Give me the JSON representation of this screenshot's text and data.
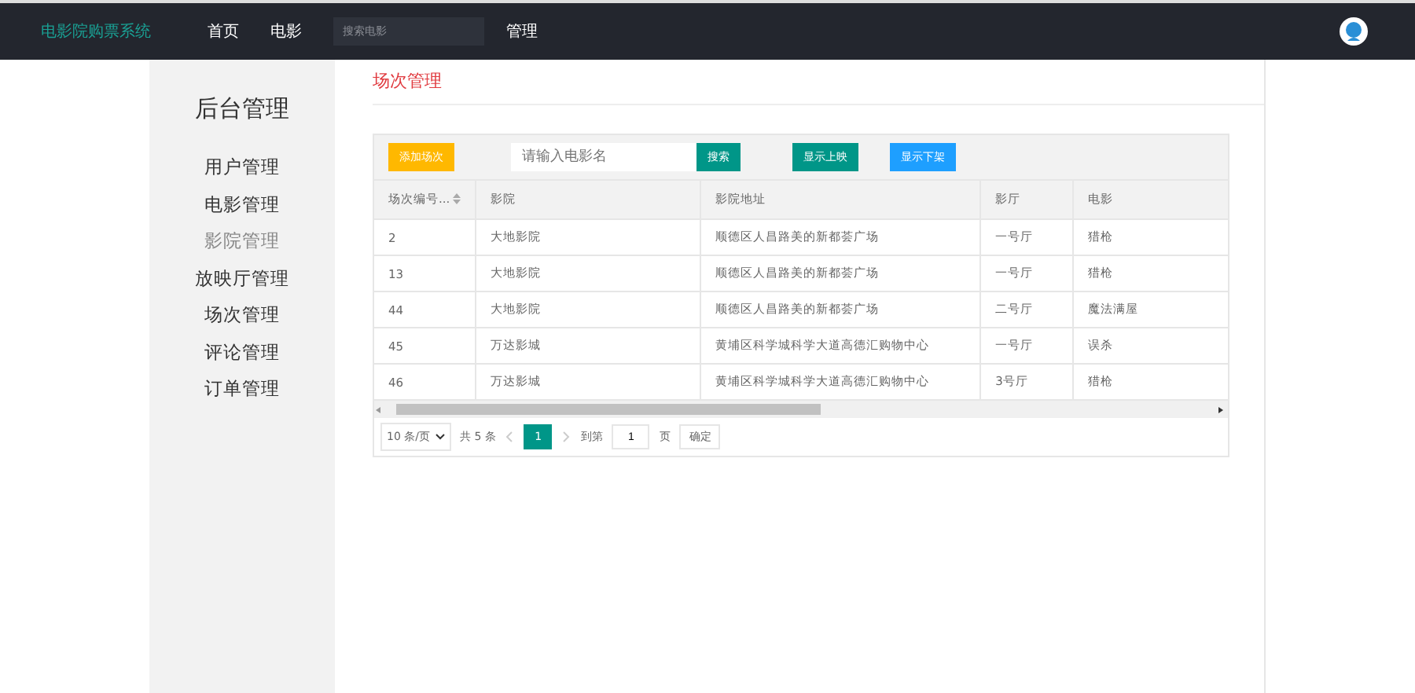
{
  "navbar": {
    "brand": "电影院购票系统",
    "links": [
      {
        "label": "首页"
      },
      {
        "label": "电影"
      }
    ],
    "search": {
      "placeholder": "搜索电影"
    },
    "admin_link": "管理"
  },
  "sidebar": {
    "title": "后台管理",
    "items": [
      {
        "label": "用户管理",
        "selected": false
      },
      {
        "label": "电影管理",
        "selected": false
      },
      {
        "label": "影院管理",
        "selected": true
      },
      {
        "label": "放映厅管理",
        "selected": false
      },
      {
        "label": "场次管理",
        "selected": false
      },
      {
        "label": "评论管理",
        "selected": false
      },
      {
        "label": "订单管理",
        "selected": false
      }
    ]
  },
  "page_title": "场次管理",
  "toolbar": {
    "buttons": [
      {
        "label": "添加场次",
        "kind": "add"
      },
      {
        "label": "搜索",
        "kind": "search"
      },
      {
        "label": "显示上映",
        "kind": "green"
      },
      {
        "label": "显示下架",
        "kind": "blue"
      }
    ],
    "search": {
      "placeholder": "请输入电影名"
    }
  },
  "table": {
    "columns": [
      "场次编号...",
      "影院",
      "影院地址",
      "影厅",
      "电影"
    ],
    "rows": [
      [
        "2",
        "大地影院",
        "顺德区人昌路美的新都荟广场",
        "一号厅",
        "猎枪"
      ],
      [
        "13",
        "大地影院",
        "顺德区人昌路美的新都荟广场",
        "一号厅",
        "猎枪"
      ],
      [
        "44",
        "大地影院",
        "顺德区人昌路美的新都荟广场",
        "二号厅",
        "魔法满屋"
      ],
      [
        "45",
        "万达影城",
        "黄埔区科学城科学大道高德汇购物中心",
        "一号厅",
        "误杀"
      ],
      [
        "46",
        "万达影城",
        "黄埔区科学城科学大道高德汇购物中心",
        "3号厅",
        "猎枪"
      ]
    ]
  },
  "pagination": {
    "page_size": "10 条/页",
    "total": "共 5 条",
    "pages": [
      {
        "label": "1",
        "selected": true
      }
    ],
    "goto_label": "到第",
    "goto_value": "1",
    "page_unit": "页",
    "confirm": "确定"
  }
}
